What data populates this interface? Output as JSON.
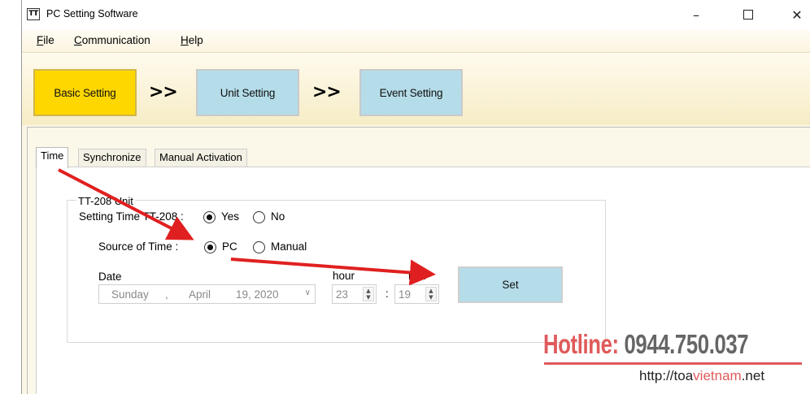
{
  "window": {
    "icon_text": "TT",
    "title": "PC Setting Software",
    "controls": {
      "minimize": "–",
      "close": "✕"
    }
  },
  "menu": {
    "items": [
      {
        "underline": "F",
        "rest": "ile"
      },
      {
        "underline": "C",
        "rest": "ommunication"
      },
      {
        "underline": "H",
        "rest": "elp"
      }
    ]
  },
  "steps": {
    "basic": "Basic Setting",
    "separator": ">>",
    "unit": "Unit Setting",
    "event": "Event Setting",
    "accent_active": "#ffd700",
    "accent_inactive": "#b5dde9"
  },
  "tabs": [
    {
      "label": "Time",
      "active": true
    },
    {
      "label": "Synchronize",
      "active": false
    },
    {
      "label": "Manual Activation",
      "active": false
    }
  ],
  "time_panel": {
    "group_title": "TT-208 Unit",
    "setting_label": "Setting Time TT-208 :",
    "setting_options": {
      "yes": "Yes",
      "no": "No",
      "selected": "Yes"
    },
    "source_label": "Source of Time :",
    "source_options": {
      "pc": "PC",
      "manual": "Manual",
      "selected": "PC"
    },
    "date_label": "Date",
    "date": {
      "weekday": "Sunday",
      "sep": ",",
      "month": "April",
      "day_year": "19, 2020"
    },
    "hour_label": "hour",
    "hour_value": "23",
    "time_sep": ":",
    "min_label": "min",
    "min_value": "19",
    "set_button": "Set"
  },
  "watermark": {
    "hotline_label": "Hotline:",
    "hotline_number": "0944.750.037",
    "url_prefix": "http://",
    "url_brand": "toa",
    "url_mid": "vietnam",
    "url_suffix": ".net",
    "accent": "#e05a5a"
  }
}
